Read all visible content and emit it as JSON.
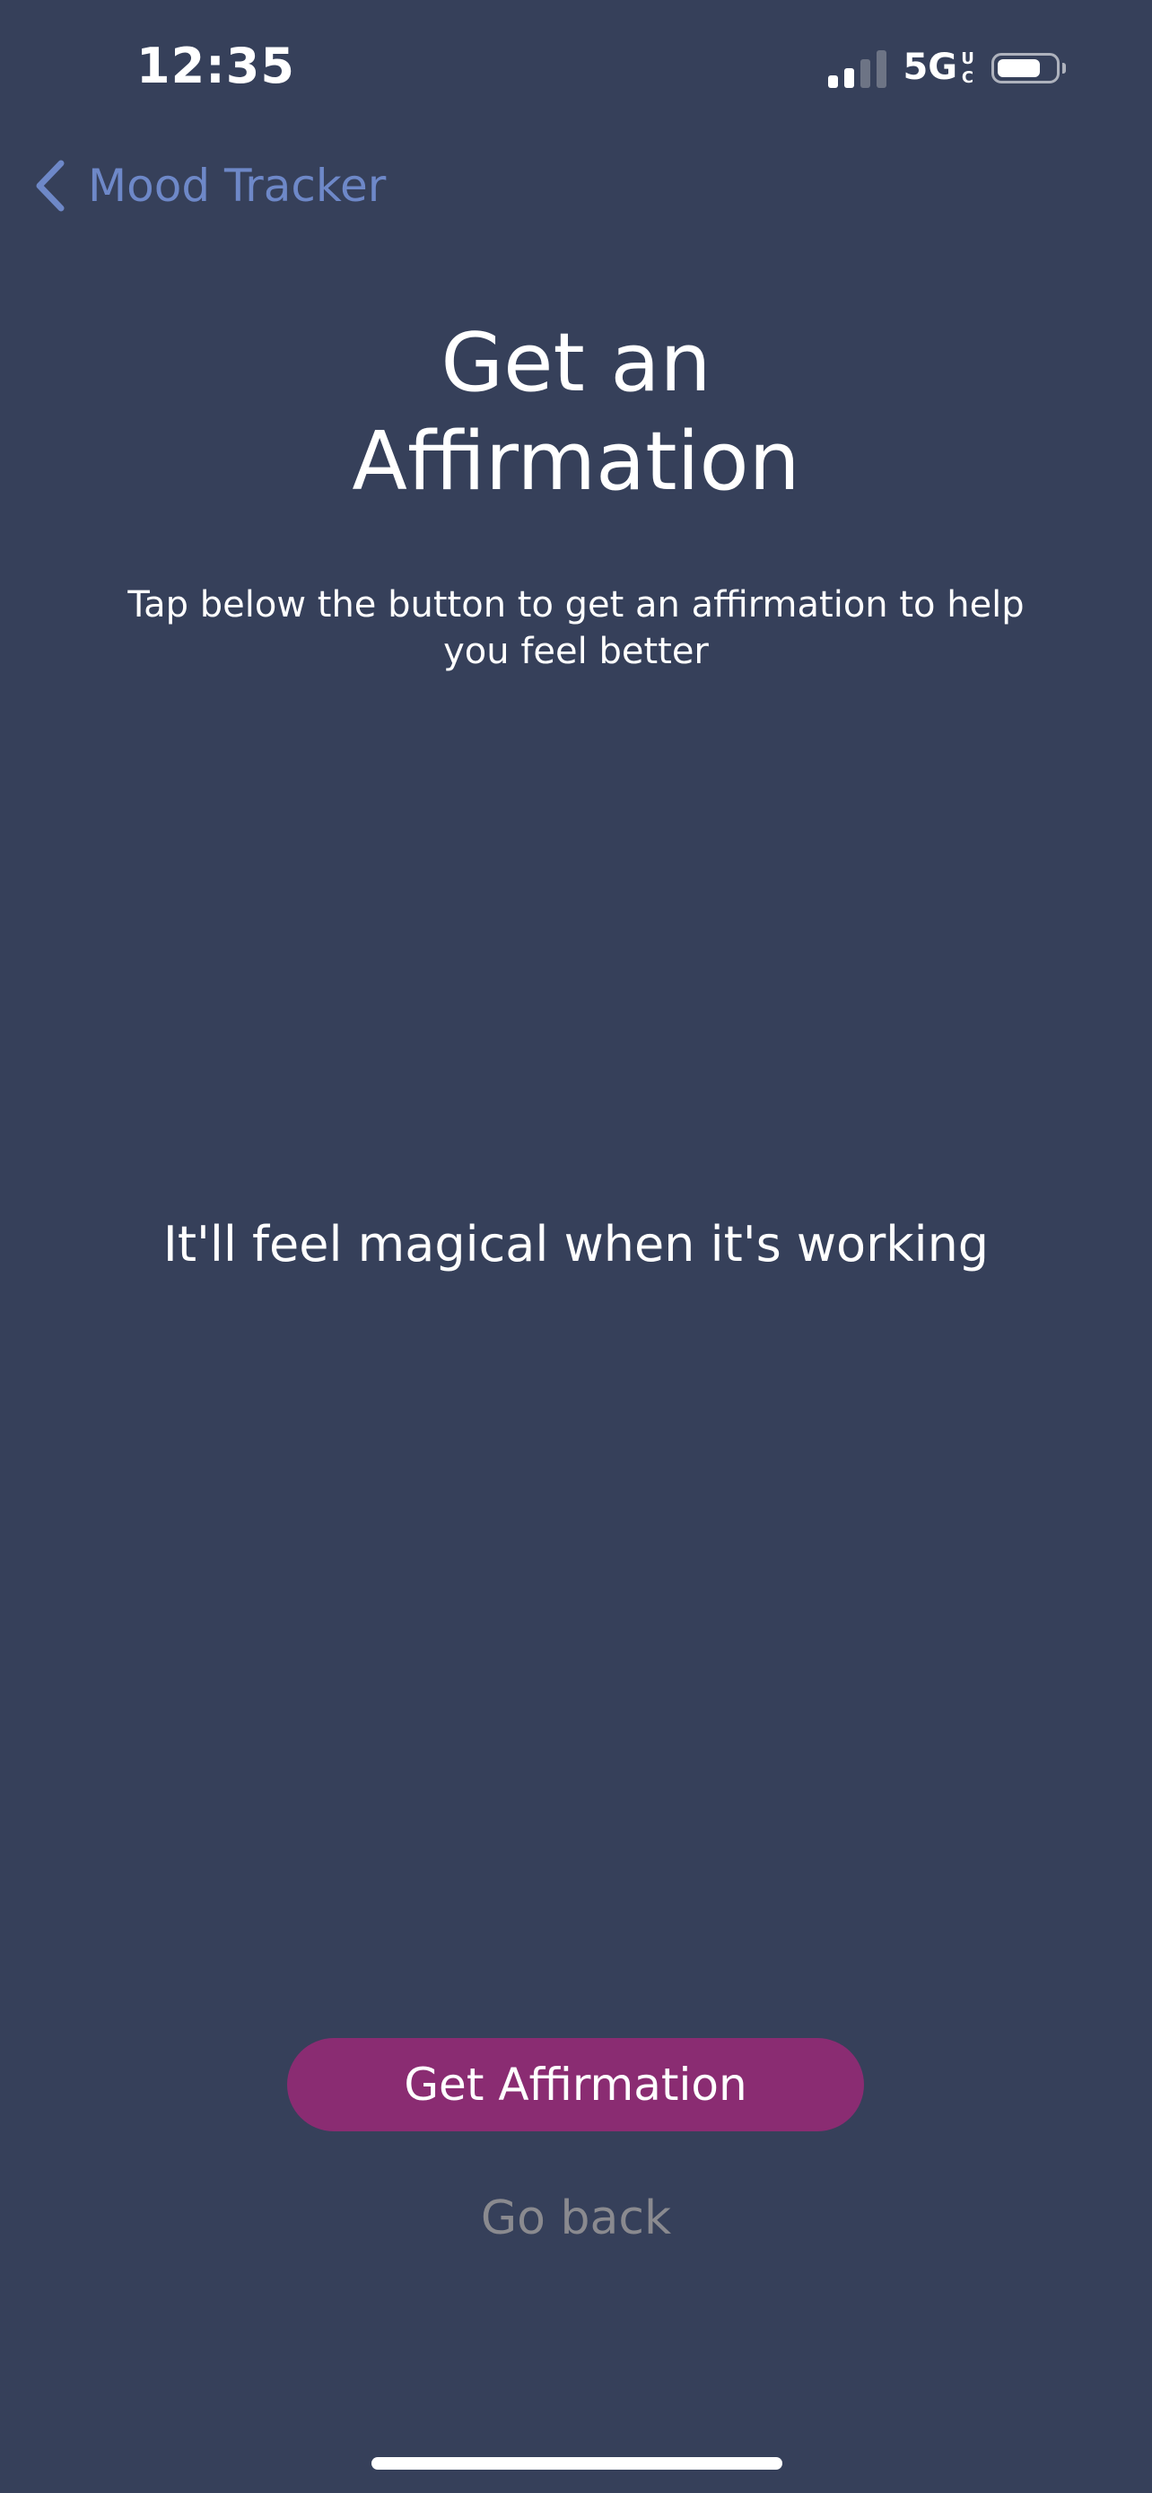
{
  "status_bar": {
    "time": "12:35",
    "network": "5G",
    "network_suffix": "UC",
    "signal_strength": 0.5,
    "battery_level": 0.75,
    "icons": [
      "signal-icon",
      "battery-icon"
    ]
  },
  "nav": {
    "back_label": "Mood Tracker",
    "back_icon": "chevron-left-icon"
  },
  "header": {
    "title_line1": "Get an",
    "title_line2": "Affirmation",
    "subtitle": "Tap below the button to get an affirmation to help you feel better"
  },
  "main": {
    "affirmation": "It'll feel magical when it's working"
  },
  "actions": {
    "primary_label": "Get Affirmation",
    "secondary_label": "Go back"
  },
  "colors": {
    "background": "#36405a",
    "accent": "#6e88c8",
    "primary_button": "#8a2c72",
    "secondary_text": "#8a8a8f",
    "signal_inactive": "#6d7485"
  }
}
